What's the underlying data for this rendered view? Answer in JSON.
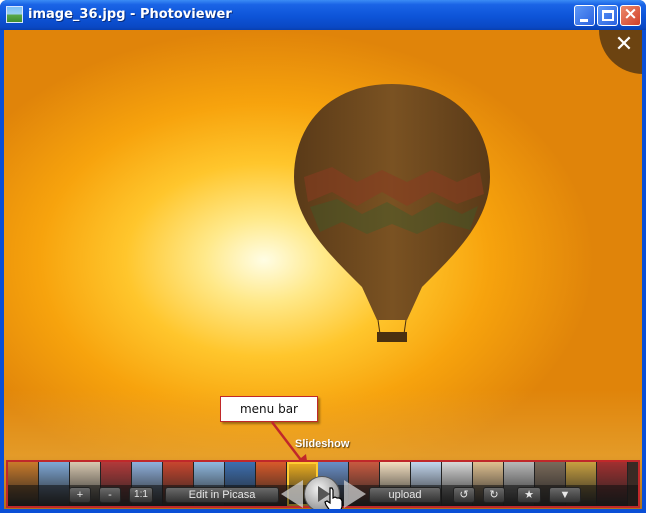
{
  "window": {
    "title": "image_36.jpg - Photoviewer",
    "controls": {
      "minimize": "minimize-icon",
      "maximize": "maximize-icon",
      "close": "close-icon"
    }
  },
  "viewer": {
    "close_glyph": "✕",
    "image_subject": "hot-air-balloon"
  },
  "annotation": {
    "callout_label": "menu bar",
    "pointer_label": "Slideshow"
  },
  "menubar": {
    "zoom_in": "+",
    "zoom_out": "-",
    "actual_size": "1:1",
    "edit": "Edit in Picasa",
    "upload": "upload",
    "rotate_left": "↺",
    "rotate_right": "↻",
    "star": "★",
    "more": "▼",
    "thumbnail_count": 20,
    "selected_thumbnail_index": 9
  },
  "colors": {
    "titlebar": "#0a48c4",
    "callout_border": "#c0282a",
    "sky": "#f7a30d"
  }
}
